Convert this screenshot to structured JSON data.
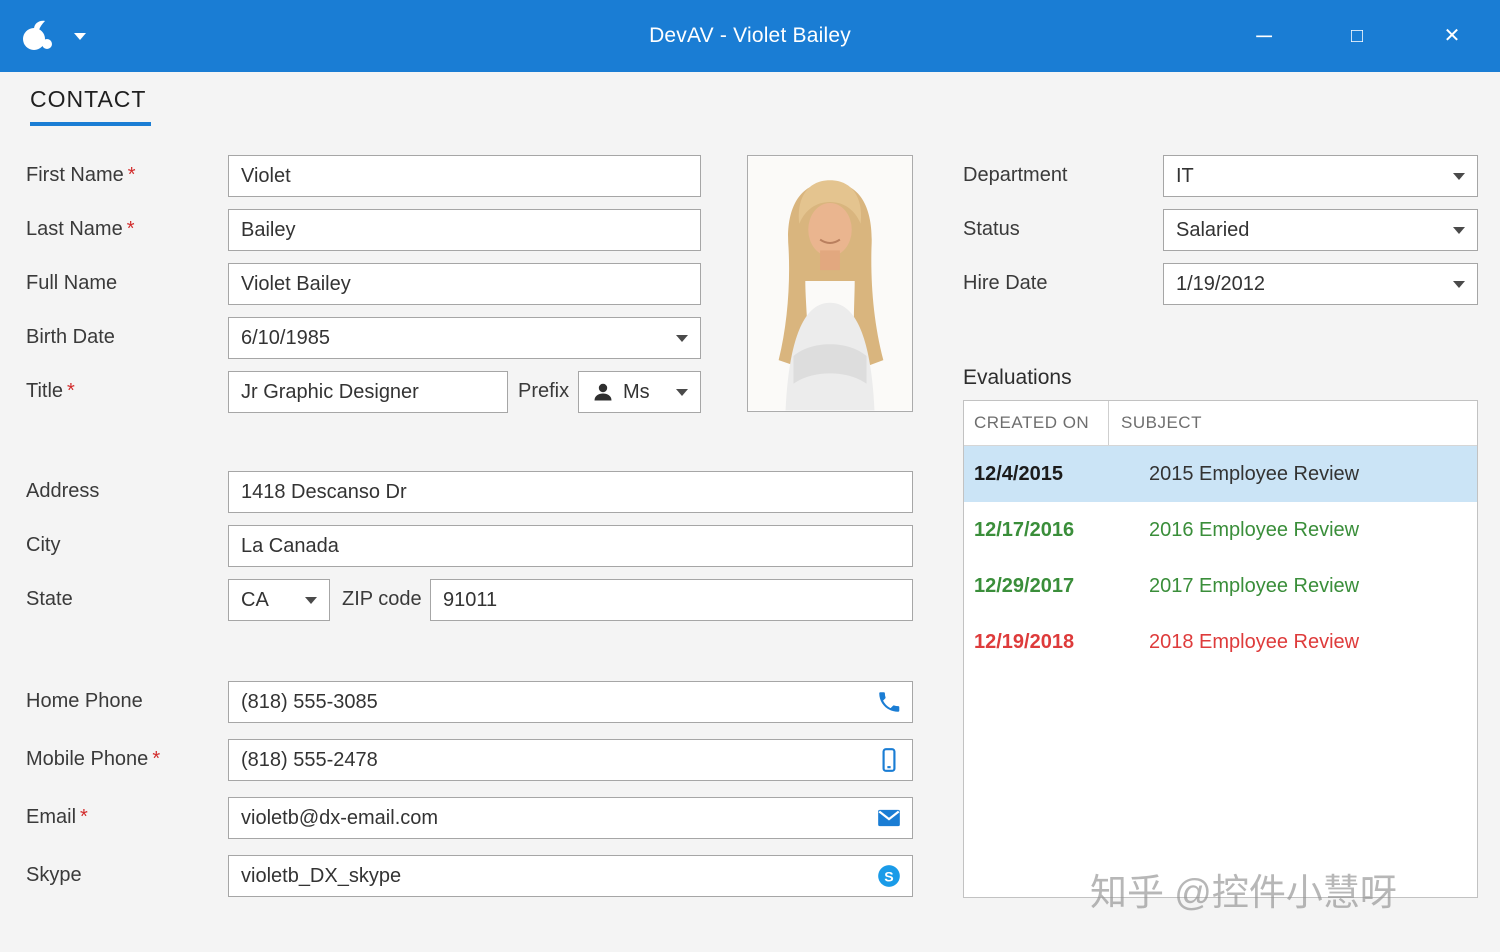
{
  "titlebar": {
    "title": "DevAV - Violet Bailey"
  },
  "icons": {
    "minimize_glyph": "─",
    "maximize_glyph": "□",
    "close_glyph": "✕"
  },
  "tab": {
    "contact": "CONTACT"
  },
  "form": {
    "first_name": {
      "label": "First Name",
      "required": "*",
      "value": "Violet"
    },
    "last_name": {
      "label": "Last Name",
      "required": "*",
      "value": "Bailey"
    },
    "full_name": {
      "label": "Full Name",
      "value": "Violet Bailey"
    },
    "birth_date": {
      "label": "Birth Date",
      "value": "6/10/1985"
    },
    "title": {
      "label": "Title",
      "required": "*",
      "value": "Jr Graphic Designer"
    },
    "prefix": {
      "label": "Prefix",
      "value": "Ms"
    },
    "address": {
      "label": "Address",
      "value": "1418 Descanso Dr"
    },
    "city": {
      "label": "City",
      "value": "La Canada"
    },
    "state": {
      "label": "State",
      "value": "CA"
    },
    "zip": {
      "label": "ZIP code",
      "value": "91011"
    },
    "home_phone": {
      "label": "Home Phone",
      "value": "(818) 555-3085"
    },
    "mobile_phone": {
      "label": "Mobile Phone",
      "required": "*",
      "value": "(818) 555-2478"
    },
    "email": {
      "label": "Email",
      "required": "*",
      "value": "violetb@dx-email.com"
    },
    "skype": {
      "label": "Skype",
      "value": "violetb_DX_skype"
    }
  },
  "details": {
    "department": {
      "label": "Department",
      "value": "IT"
    },
    "status": {
      "label": "Status",
      "value": "Salaried"
    },
    "hire_date": {
      "label": "Hire Date",
      "value": "1/19/2012"
    }
  },
  "evaluations": {
    "title": "Evaluations",
    "columns": {
      "created_on": "CREATED ON",
      "subject": "SUBJECT"
    },
    "rows": [
      {
        "date": "12/4/2015",
        "subject": "2015 Employee Review",
        "state": "selected"
      },
      {
        "date": "12/17/2016",
        "subject": "2016 Employee Review",
        "state": "green"
      },
      {
        "date": "12/29/2017",
        "subject": "2017 Employee Review",
        "state": "green"
      },
      {
        "date": "12/19/2018",
        "subject": "2018 Employee Review",
        "state": "red"
      }
    ]
  },
  "watermark": "知乎 @控件小慧呀",
  "colors": {
    "accent": "#1a7dd4",
    "selected_row": "#cbe4f6",
    "positive": "#3a8e3a",
    "negative": "#de3b3b",
    "required": "#d22b2b"
  }
}
